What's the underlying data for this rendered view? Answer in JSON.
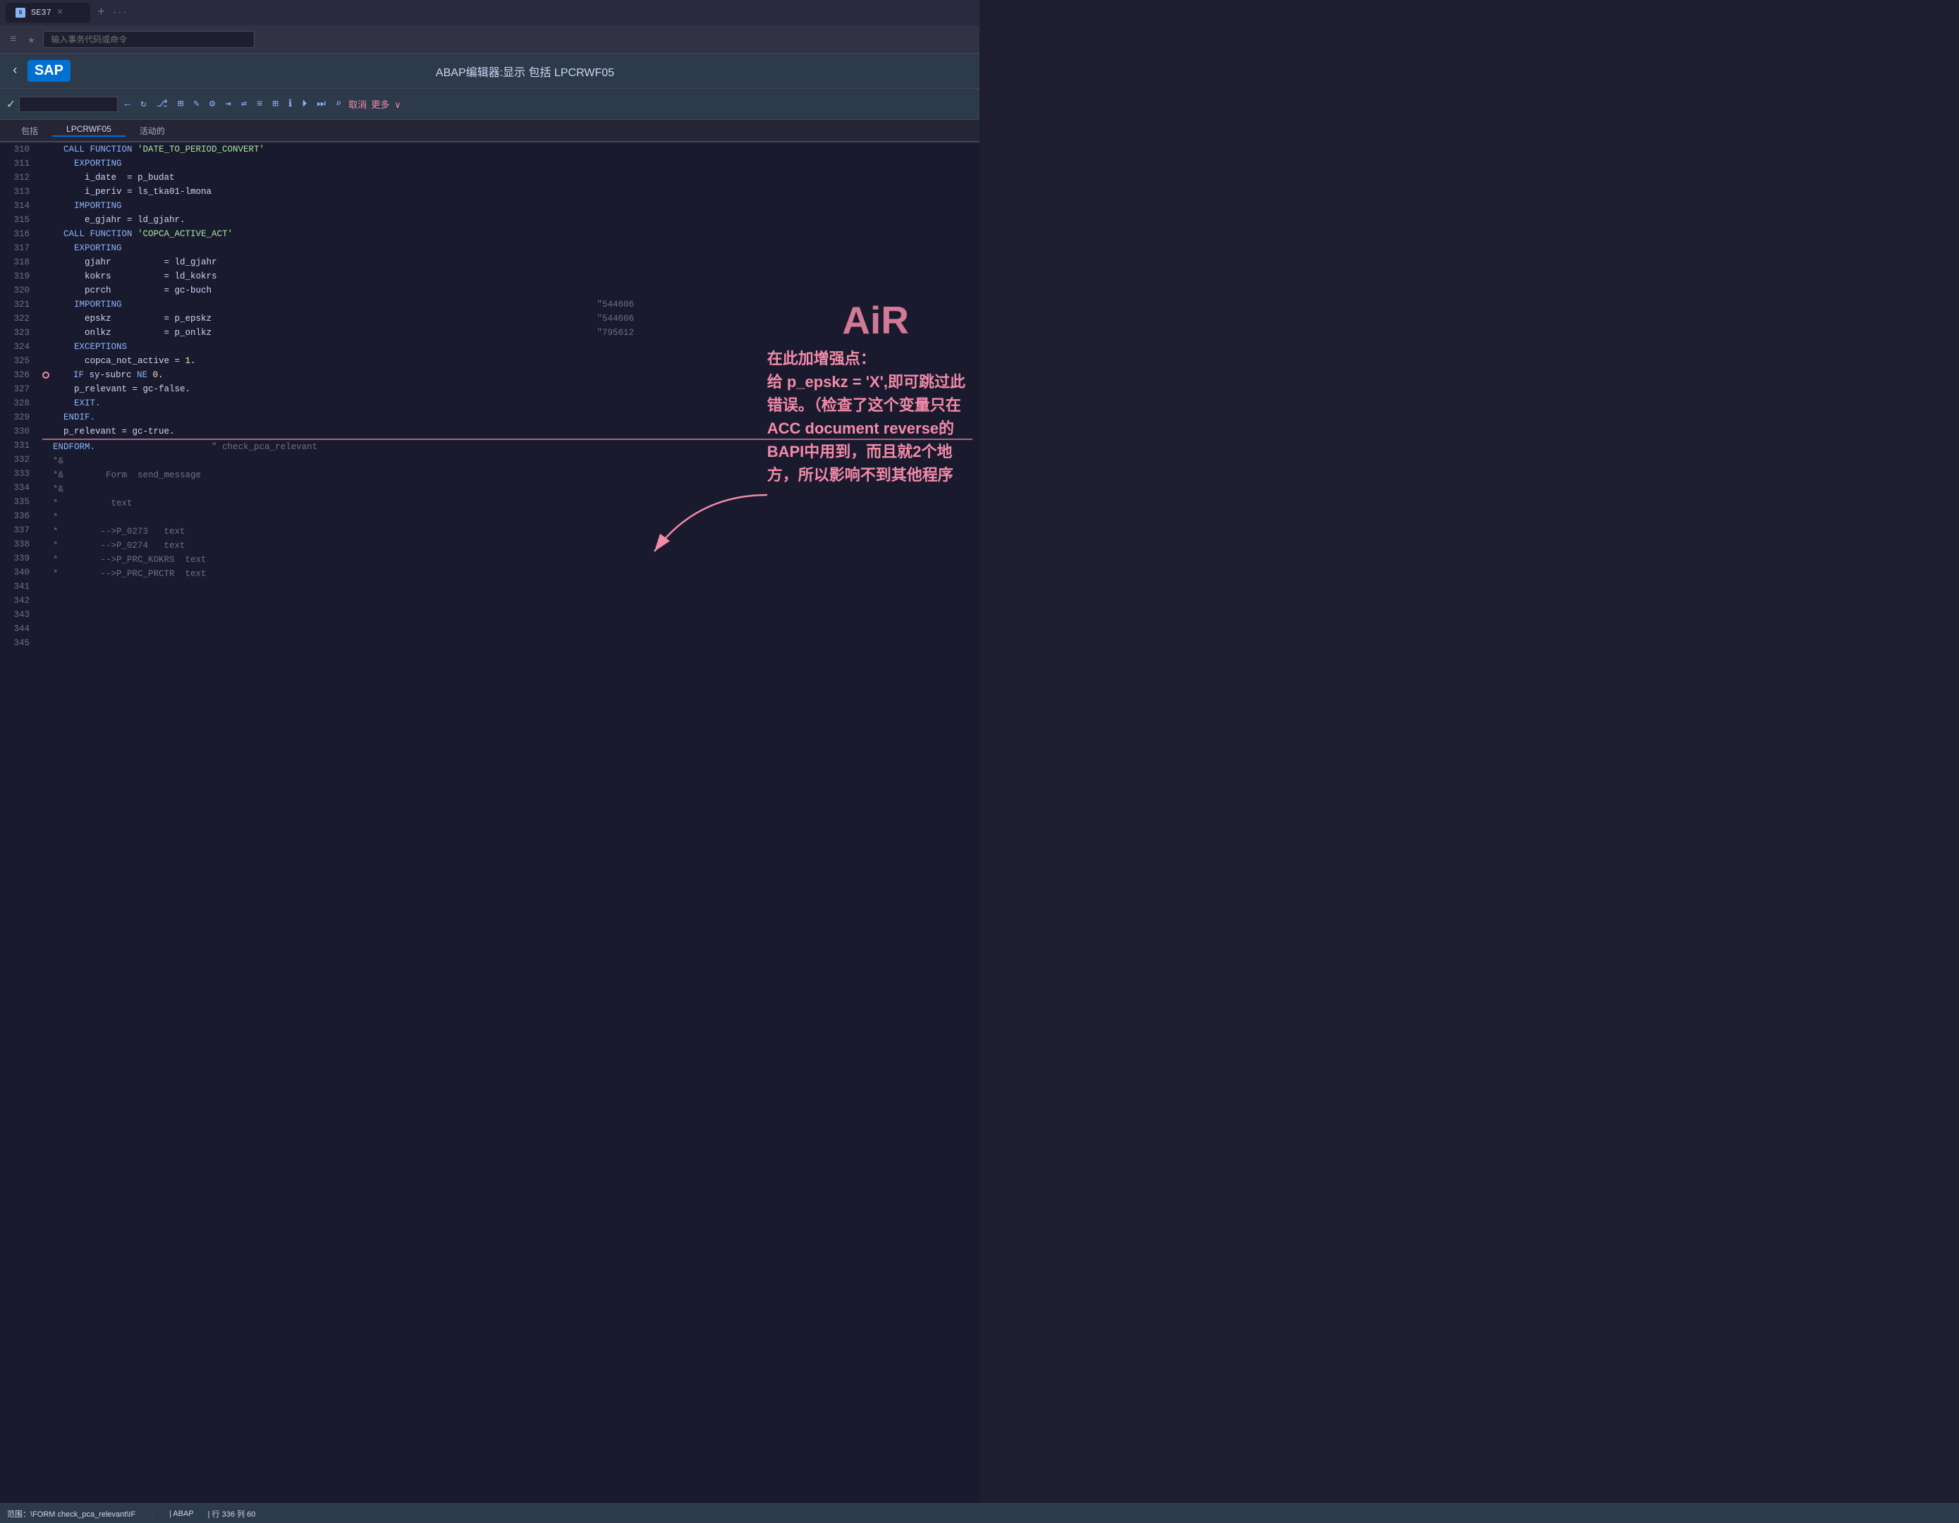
{
  "browser": {
    "tab_label": "SE37",
    "address_placeholder": "输入事务代码或命令",
    "new_tab_icon": "+",
    "more_icon": "···"
  },
  "sap": {
    "logo": "SAP",
    "title": "ABAP编辑器:显示 包括 LPCRWF05",
    "back_icon": "‹"
  },
  "toolbar": {
    "check_icon": "✓",
    "cancel_label": "取消",
    "more_label": "更多 ∨"
  },
  "breadcrumb": {
    "items": [
      {
        "label": "包括",
        "active": false
      },
      {
        "label": "LPCRWF05",
        "active": true
      },
      {
        "label": "活动的",
        "active": false
      }
    ]
  },
  "annotation": {
    "air_label": "AiR",
    "text": "在此加增强点：\n给 p_epskz = 'X',即可跳过此\n错误。（检查了这个变量只在\nACC document reverse的\nBAPI中用到，而且就2个地\n方，所以影响不到其他程序"
  },
  "status_bar": {
    "scope": "范围：\\FORM check_pca_relevant\\IF",
    "lang": "| ABAP",
    "position": "| 行 336 列 60"
  },
  "code_lines": [
    {
      "num": "310",
      "content": "",
      "type": "normal"
    },
    {
      "num": "311",
      "content": "    CALL FUNCTION 'DATE_TO_PERIOD_CONVERT'",
      "type": "normal",
      "parts": [
        {
          "t": "kw",
          "v": "    CALL FUNCTION "
        },
        {
          "t": "str",
          "v": "'DATE_TO_PERIOD_CONVERT'"
        }
      ]
    },
    {
      "num": "312",
      "content": "      EXPORTING",
      "type": "normal",
      "parts": [
        {
          "t": "kw",
          "v": "      EXPORTING"
        }
      ]
    },
    {
      "num": "313",
      "content": "        i_date  = p_budat",
      "type": "normal",
      "parts": [
        {
          "t": "var",
          "v": "        i_date  = p_budat"
        }
      ]
    },
    {
      "num": "314",
      "content": "        i_periv = ls_tka01-lmona",
      "type": "normal",
      "parts": [
        {
          "t": "var",
          "v": "        i_periv = ls_tka01-lmona"
        }
      ]
    },
    {
      "num": "315",
      "content": "      IMPORTING",
      "type": "normal",
      "parts": [
        {
          "t": "kw",
          "v": "      IMPORTING"
        }
      ]
    },
    {
      "num": "316",
      "content": "        e_gjahr = ld_gjahr.",
      "type": "normal",
      "parts": [
        {
          "t": "var",
          "v": "        e_gjahr = ld_gjahr."
        }
      ]
    },
    {
      "num": "317",
      "content": "",
      "type": "normal"
    },
    {
      "num": "318",
      "content": "    CALL FUNCTION 'COPCA_ACTIVE_ACT'",
      "type": "normal",
      "parts": [
        {
          "t": "kw",
          "v": "    CALL FUNCTION "
        },
        {
          "t": "str",
          "v": "'COPCA_ACTIVE_ACT'"
        }
      ]
    },
    {
      "num": "319",
      "content": "      EXPORTING",
      "type": "normal",
      "parts": [
        {
          "t": "kw",
          "v": "      EXPORTING"
        }
      ]
    },
    {
      "num": "320",
      "content": "        gjahr          = ld_gjahr",
      "type": "normal",
      "parts": [
        {
          "t": "var",
          "v": "        gjahr          = ld_gjahr"
        }
      ]
    },
    {
      "num": "321",
      "content": "        kokrs          = ld_kokrs",
      "type": "normal",
      "parts": [
        {
          "t": "var",
          "v": "        kokrs          = ld_kokrs"
        }
      ]
    },
    {
      "num": "322",
      "content": "        pcrch          = gc-buch",
      "type": "normal",
      "parts": [
        {
          "t": "var",
          "v": "        pcrch          = gc-buch"
        }
      ]
    },
    {
      "num": "323",
      "content": "      IMPORTING",
      "type": "normal",
      "comment_right": "\"544606",
      "parts": [
        {
          "t": "kw",
          "v": "      IMPORTING"
        }
      ]
    },
    {
      "num": "324",
      "content": "        epskz          = p_epskz",
      "type": "normal",
      "comment_right": "\"544606",
      "parts": [
        {
          "t": "var",
          "v": "        epskz          = p_epskz"
        }
      ]
    },
    {
      "num": "325",
      "content": "        onlkz          = p_onlkz",
      "type": "normal",
      "comment_right": "\"795612",
      "parts": [
        {
          "t": "var",
          "v": "        onlkz          = p_onlkz"
        }
      ]
    },
    {
      "num": "326",
      "content": "      EXCEPTIONS",
      "type": "normal",
      "parts": [
        {
          "t": "kw",
          "v": "      EXCEPTIONS"
        }
      ]
    },
    {
      "num": "327",
      "content": "        copca_not_active = 1.",
      "type": "normal",
      "parts": [
        {
          "t": "var",
          "v": "        copca_not_active = "
        },
        {
          "t": "num",
          "v": "1."
        }
      ]
    },
    {
      "num": "328",
      "content": "",
      "type": "normal"
    },
    {
      "num": "329",
      "content": "    IF sy-subrc NE 0.",
      "type": "normal",
      "breakpoint": true,
      "parts": [
        {
          "t": "kw",
          "v": "    IF "
        },
        {
          "t": "var",
          "v": "sy-subrc "
        },
        {
          "t": "kw",
          "v": "NE "
        },
        {
          "t": "num",
          "v": "0."
        }
      ]
    },
    {
      "num": "330",
      "content": "      p_relevant = gc-false.",
      "type": "normal",
      "parts": [
        {
          "t": "var",
          "v": "      p_relevant = gc-false."
        }
      ]
    },
    {
      "num": "331",
      "content": "      EXIT.",
      "type": "normal",
      "parts": [
        {
          "t": "kw",
          "v": "      EXIT."
        }
      ]
    },
    {
      "num": "332",
      "content": "    ENDIF.",
      "type": "normal",
      "parts": [
        {
          "t": "kw",
          "v": "    ENDIF."
        }
      ]
    },
    {
      "num": "333",
      "content": "",
      "type": "normal"
    },
    {
      "num": "334",
      "content": "    p_relevant = gc-true.",
      "type": "normal",
      "parts": [
        {
          "t": "var",
          "v": "    p_relevant = gc-true."
        }
      ]
    },
    {
      "num": "335",
      "content": "",
      "type": "highlighted"
    },
    {
      "num": "336",
      "content": "  ENDFORM.                      \" check_pca_relevant",
      "type": "normal",
      "parts": [
        {
          "t": "kw",
          "v": "  ENDFORM."
        },
        {
          "t": "var",
          "v": "                      "
        },
        {
          "t": "cmt",
          "v": "\" check_pca_relevant"
        }
      ]
    },
    {
      "num": "337",
      "content": "  *&",
      "type": "normal",
      "parts": [
        {
          "t": "cmt",
          "v": "  *&"
        }
      ]
    },
    {
      "num": "338",
      "content": "  *&        Form  send_message",
      "type": "normal",
      "parts": [
        {
          "t": "cmt",
          "v": "  *&        Form  send_message"
        }
      ]
    },
    {
      "num": "339",
      "content": "  *&",
      "type": "normal",
      "parts": [
        {
          "t": "cmt",
          "v": "  *&"
        }
      ]
    },
    {
      "num": "340",
      "content": "  *          text",
      "type": "normal",
      "parts": [
        {
          "t": "cmt",
          "v": "  *          text"
        }
      ]
    },
    {
      "num": "341",
      "content": "  *",
      "type": "normal",
      "parts": [
        {
          "t": "cmt",
          "v": "  *"
        }
      ]
    },
    {
      "num": "342",
      "content": "  *        -->P_0273   text",
      "type": "normal",
      "parts": [
        {
          "t": "cmt",
          "v": "  *        -->P_0273   text"
        }
      ]
    },
    {
      "num": "343",
      "content": "  *        -->P_0274   text",
      "type": "normal",
      "parts": [
        {
          "t": "cmt",
          "v": "  *        -->P_0274   text"
        }
      ]
    },
    {
      "num": "344",
      "content": "  *        -->P_PRC_KOKRS  text",
      "type": "normal",
      "parts": [
        {
          "t": "cmt",
          "v": "  *        -->P_PRC_KOKRS  text"
        }
      ]
    },
    {
      "num": "345",
      "content": "  *        -->P_PRC_PRCTR  text",
      "type": "normal",
      "parts": [
        {
          "t": "cmt",
          "v": "  *        -->P_PRC_PRCTR  text"
        }
      ]
    }
  ]
}
